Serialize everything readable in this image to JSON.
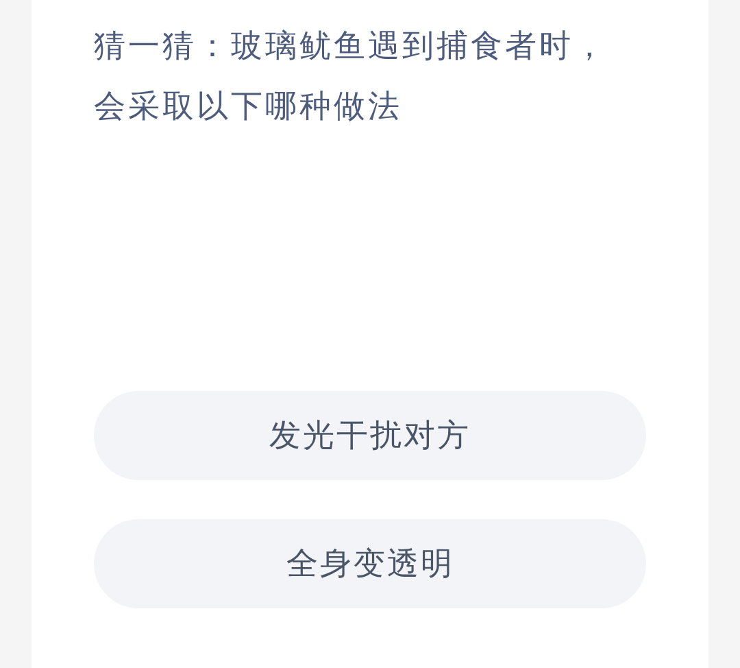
{
  "question": "猜一猜：玻璃鱿鱼遇到捕食者时，会采取以下哪种做法",
  "options": [
    {
      "label": "发光干扰对方"
    },
    {
      "label": "全身变透明"
    }
  ]
}
